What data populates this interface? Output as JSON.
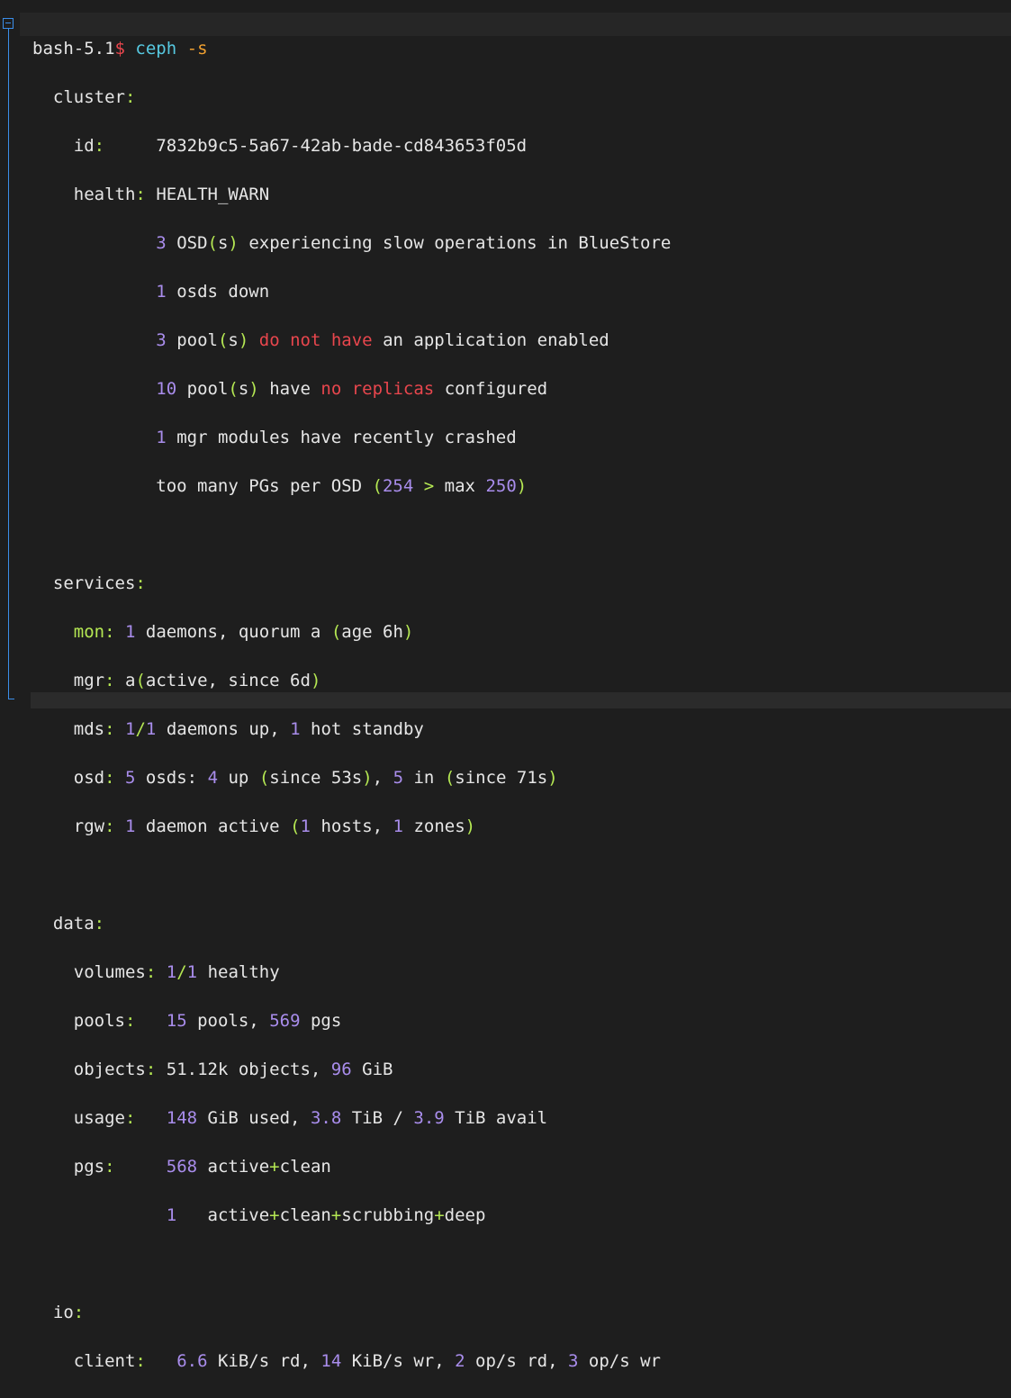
{
  "prompt": {
    "shell": "bash-5.1",
    "symbol": "$",
    "command": "ceph",
    "flag": "-s"
  },
  "cluster": {
    "section": "cluster",
    "id_key": "id",
    "id_value": "7832b9c5-5a67-42ab-bade-cd843653f05d",
    "health_key": "health",
    "health_value": "HEALTH_WARN",
    "warnings": {
      "w1_num": "3",
      "w1_a": "OSD",
      "w1_b": "s",
      "w1_c": "experiencing slow operations in BlueStore",
      "w2_num": "1",
      "w2_text": "osds down",
      "w3_num": "3",
      "w3_a": "pool",
      "w3_b": "s",
      "w3_red": "do not have",
      "w3_c": "an application enabled",
      "w4_num": "10",
      "w4_a": "pool",
      "w4_b": "s",
      "w4_c": "have",
      "w4_red": "no replicas",
      "w4_d": "configured",
      "w5_num": "1",
      "w5_text": "mgr modules have recently crashed",
      "w6_text": "too many PGs per OSD",
      "w6_n1": "254",
      "w6_gt": ">",
      "w6_max": "max",
      "w6_n2": "250"
    }
  },
  "services": {
    "section": "services",
    "mon_key": "mon",
    "mon_n": "1",
    "mon_a": "daemons, quorum a",
    "mon_b": "age 6h",
    "mgr_key": "mgr",
    "mgr_a": "a",
    "mgr_b": "active, since 6d",
    "mds_key": "mds",
    "mds_n1": "1",
    "mds_n2": "1",
    "mds_a": "daemons up,",
    "mds_n3": "1",
    "mds_b": "hot standby",
    "osd_key": "osd",
    "osd_n1": "5",
    "osd_a": "osds:",
    "osd_n2": "4",
    "osd_b": "up",
    "osd_c": "since 53s",
    "osd_n3": "5",
    "osd_d": "in",
    "osd_e": "since 71s",
    "rgw_key": "rgw",
    "rgw_n1": "1",
    "rgw_a": "daemon active",
    "rgw_n2": "1",
    "rgw_b": "hosts,",
    "rgw_n3": "1",
    "rgw_c": "zones"
  },
  "data": {
    "section": "data",
    "volumes_key": "volumes",
    "volumes_n1": "1",
    "volumes_n2": "1",
    "volumes_text": "healthy",
    "pools_key": "pools",
    "pools_n1": "15",
    "pools_a": "pools,",
    "pools_n2": "569",
    "pools_b": "pgs",
    "objects_key": "objects",
    "objects_a": "51.12k objects,",
    "objects_n": "96",
    "objects_b": "GiB",
    "usage_key": "usage",
    "usage_n1": "148",
    "usage_a": "GiB used,",
    "usage_n2": "3.8",
    "usage_b": "TiB /",
    "usage_n3": "3.9",
    "usage_c": "TiB avail",
    "pgs_key": "pgs",
    "pgs_n1": "568",
    "pgs_a1": "active",
    "pgs_a2": "clean",
    "pgs_n2": "1",
    "pgs_b1": "active",
    "pgs_b2": "clean",
    "pgs_b3": "scrubbing",
    "pgs_b4": "deep"
  },
  "io": {
    "section": "io",
    "client_key": "client",
    "n1": "6.6",
    "a": "KiB/s rd,",
    "n2": "14",
    "b": "KiB/s wr,",
    "n3": "2",
    "c": "op/s rd,",
    "n4": "3",
    "d": "op/s wr"
  },
  "colors": {
    "background": "#1e1e1e",
    "text": "#e6e6e6",
    "punctuation": "#b5e853",
    "number": "#a98dec",
    "warning": "#e8464d",
    "command": "#56c8e0",
    "flag": "#f0a030",
    "fold": "#3b8eea"
  },
  "icons": {
    "fold": "collapse-fold-icon"
  }
}
